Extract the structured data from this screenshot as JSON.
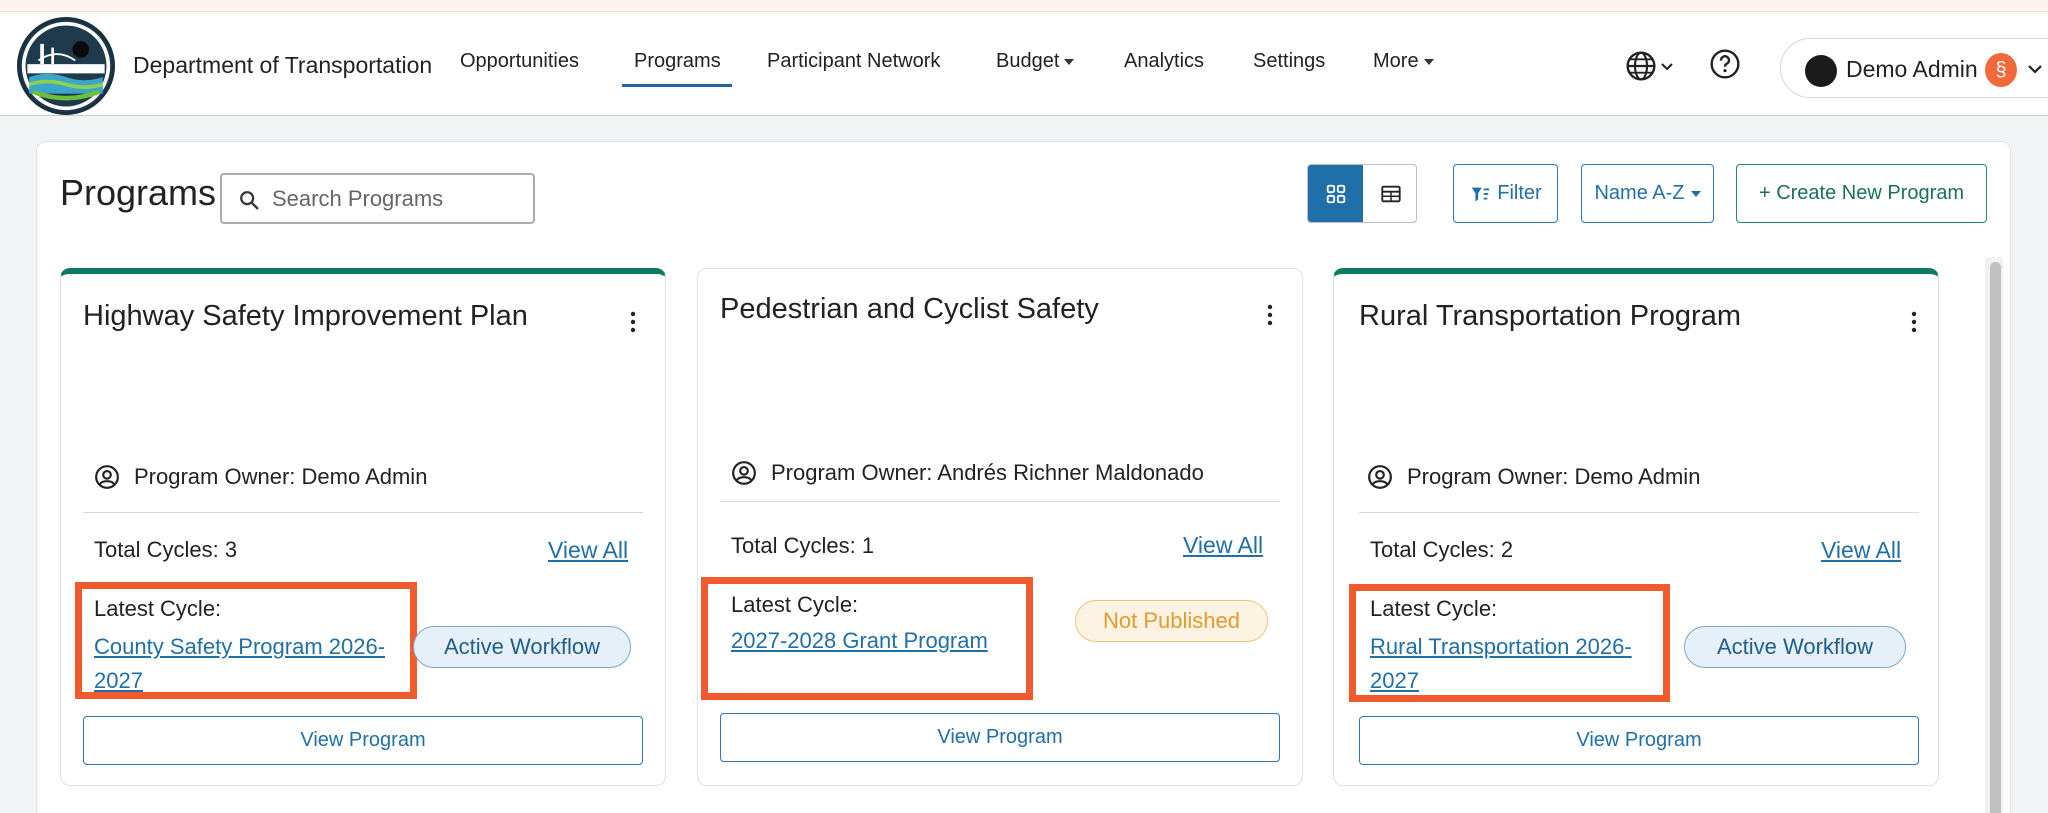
{
  "app": {
    "org_name": "Department of Transportation"
  },
  "nav": {
    "items": [
      {
        "label": "Opportunities"
      },
      {
        "label": "Programs"
      },
      {
        "label": "Participant Network"
      },
      {
        "label": "Budget"
      },
      {
        "label": "Analytics"
      },
      {
        "label": "Settings"
      },
      {
        "label": "More"
      }
    ],
    "active": "Programs"
  },
  "user": {
    "name": "Demo Admin",
    "badge_icon": "s-logo-icon"
  },
  "page": {
    "title": "Programs",
    "search_placeholder": "Search Programs",
    "view_mode": "grid",
    "filter_label": "Filter",
    "sort_label": "Name A-Z",
    "create_label": "+ Create New Program"
  },
  "colors": {
    "accent_green": "#0f7a62",
    "link_blue": "#1f6fa8",
    "highlight_orange": "#f15a2c",
    "view_toggle_active": "#1f6fa8"
  },
  "cards": [
    {
      "title": "Highway Safety Improvement Plan",
      "owner": "Program Owner: Demo Admin",
      "total_cycles": "Total Cycles: 3",
      "view_all": "View All",
      "latest_cycle_label": "Latest Cycle:",
      "latest_cycle_link": "County Safety Program 2026-2027",
      "status": "Active Workflow",
      "view_program": "View Program",
      "accent": true
    },
    {
      "title": "Pedestrian and Cyclist Safety",
      "owner": "Program Owner: Andrés Richner Maldonado",
      "total_cycles": "Total Cycles: 1",
      "view_all": "View All",
      "latest_cycle_label": "Latest Cycle:",
      "latest_cycle_link": "2027-2028 Grant Program",
      "status": "Not Published",
      "view_program": "View Program",
      "accent": false
    },
    {
      "title": "Rural Transportation Program",
      "owner": "Program Owner: Demo Admin",
      "total_cycles": "Total Cycles: 2",
      "view_all": "View All",
      "latest_cycle_label": "Latest Cycle:",
      "latest_cycle_link": "Rural Transportation 2026-2027",
      "status": "Active Workflow",
      "view_program": "View Program",
      "accent": true
    }
  ]
}
